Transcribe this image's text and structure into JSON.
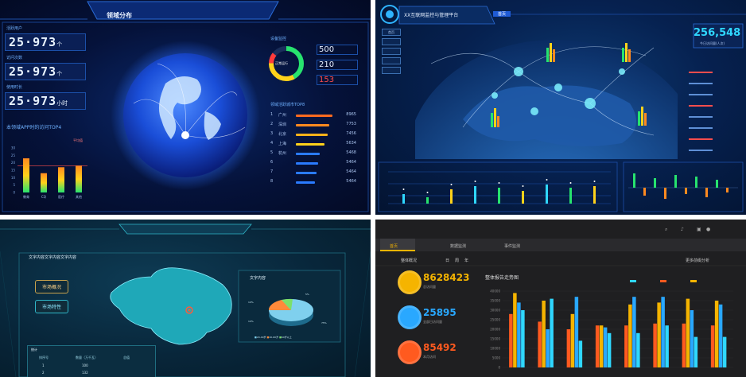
{
  "colors": {
    "cyan": "#2fd7ff",
    "orange": "#ff8a1f",
    "yellow": "#ffd21a",
    "green": "#27e36e",
    "red": "#ff3b3b",
    "blue": "#2a7bff",
    "dark_bg": "#1f1f21"
  },
  "panel1": {
    "tabs": [
      "领域分布",
      "",
      "",
      ""
    ],
    "labels": [
      "活跃用户",
      "访问次数",
      "使用时长"
    ],
    "counters": [
      "25·973",
      "25·973",
      "25·973"
    ],
    "units": [
      "个",
      "个",
      "小时"
    ],
    "chart_title": "本领域APP时的访问TOP4",
    "legend_label": "平均值",
    "y_ticks": [
      "30",
      "25",
      "20",
      "15",
      "10",
      "5",
      "0"
    ],
    "x_cats": [
      "教育",
      "CQ",
      "医疗",
      "其他"
    ],
    "device_label": "设备监控",
    "gauge_center": "正常运行",
    "device_values": [
      "500",
      "210",
      "153"
    ],
    "rank_title": "领域活跃城市TOP8",
    "rank_rows": [
      {
        "num": "1",
        "city": "广州",
        "val": "8965"
      },
      {
        "num": "2",
        "city": "深圳",
        "val": "7753"
      },
      {
        "num": "3",
        "city": "北京",
        "val": "7456"
      },
      {
        "num": "4",
        "city": "上海",
        "val": "5634"
      },
      {
        "num": "5",
        "city": "杭州",
        "val": "5468"
      },
      {
        "num": "6",
        "city": "",
        "val": "5464"
      },
      {
        "num": "7",
        "city": "",
        "val": "5464"
      },
      {
        "num": "8",
        "city": "",
        "val": "5464"
      }
    ]
  },
  "panel2": {
    "title": "XX互联网监控与管理平台",
    "nav": [
      "首页",
      "",
      "",
      "",
      ""
    ],
    "big_number": "256,548",
    "big_sub": "今日访问量(人次)",
    "sidebar": [
      "首页",
      "",
      "",
      "",
      ""
    ],
    "list_tabs": [
      "",
      "",
      ""
    ],
    "list_rows": [
      "",
      "",
      "",
      "",
      "",
      "",
      "",
      ""
    ],
    "map_labels": [
      "",
      "",
      "",
      ""
    ]
  },
  "panel3": {
    "title": "文字内容文字内容文字内容",
    "btn1": "市场概况",
    "btn2": "市场特性",
    "pie_title": "文字内容",
    "pie_legend": [
      "20-40岁",
      "40-60岁",
      "60岁以上"
    ],
    "pie_pct": [
      "10%",
      "5%",
      "75%",
      "10%"
    ],
    "table_title": "统计",
    "table_headers": [
      "排序号",
      "数量（万千瓦）",
      "总值"
    ],
    "table_rows": [
      [
        "1",
        "100",
        ""
      ],
      [
        "2",
        "132",
        ""
      ]
    ]
  },
  "panel4": {
    "nav": [
      "首页",
      "数据监测",
      "事件监测",
      "",
      "",
      "",
      ""
    ],
    "filter": "整体概况",
    "filter_opts": [
      "日",
      "周",
      "年"
    ],
    "more": "更多前缀分析",
    "chart_title": "整体报告走势图",
    "legend": [
      "",
      "",
      ""
    ],
    "stats": [
      {
        "value": "8628423",
        "label": "总访问量",
        "color": "#f5b400"
      },
      {
        "value": "25895",
        "label": "全部日访问量",
        "color": "#29a8ff"
      },
      {
        "value": "85492",
        "label": "本月访问",
        "color": "#ff5a1f"
      }
    ],
    "y_ticks": [
      "40000",
      "35000",
      "30000",
      "25000",
      "20000",
      "15000",
      "10000",
      "5000",
      "0"
    ]
  },
  "chart_data": [
    {
      "type": "bar",
      "title": "本领域APP时的访问TOP4",
      "categories": [
        "教育",
        "CQ",
        "医疗",
        "其他"
      ],
      "values": [
        23,
        13,
        17,
        18
      ],
      "ylim": [
        0,
        30
      ]
    },
    {
      "type": "bar",
      "categories": [
        "1",
        "2",
        "3",
        "4",
        "5",
        "6",
        "7",
        "8"
      ],
      "series": [
        {
          "name": "",
          "values": [
            28000,
            24000,
            20000,
            22000,
            22000,
            23000,
            23000,
            22000
          ]
        },
        {
          "name": "",
          "values": [
            39000,
            35000,
            28000,
            22000,
            33000,
            34000,
            36000,
            35000
          ]
        },
        {
          "name": "",
          "values": [
            34000,
            20000,
            37000,
            21000,
            37000,
            37000,
            30000,
            33000
          ]
        },
        {
          "name": "",
          "values": [
            30000,
            36000,
            14000,
            18000,
            18000,
            22000,
            16000,
            16000
          ]
        }
      ],
      "ylim": [
        0,
        40000
      ]
    }
  ]
}
